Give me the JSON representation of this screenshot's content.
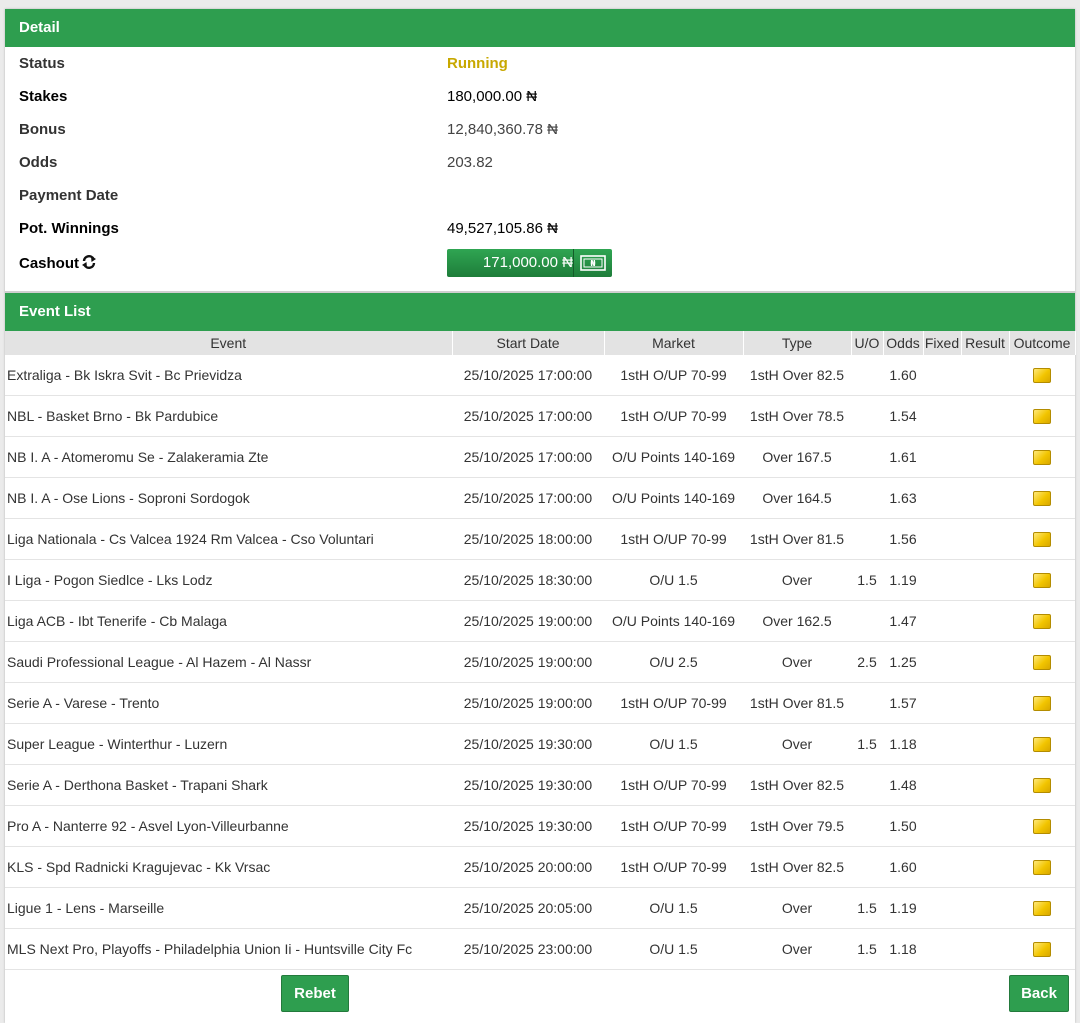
{
  "detail": {
    "header": "Detail",
    "status_label": "Status",
    "status_value": "Running",
    "stakes_label": "Stakes",
    "stakes_value": "180,000.00 ₦",
    "bonus_label": "Bonus",
    "bonus_value": "12,840,360.78 ₦",
    "odds_label": "Odds",
    "odds_value": "203.82",
    "payment_date_label": "Payment Date",
    "payment_date_value": "",
    "pot_winnings_label": "Pot. Winnings",
    "pot_winnings_value": "49,527,105.86 ₦",
    "cashout_label": "Cashout",
    "cashout_value": "171,000.00 ₦"
  },
  "events": {
    "header": "Event List",
    "columns": [
      "Event",
      "Start Date",
      "Market",
      "Type",
      "U/O",
      "Odds",
      "Fixed",
      "Result",
      "Outcome"
    ],
    "rows": [
      {
        "event": "Extraliga - Bk Iskra Svit - Bc Prievidza",
        "start": "25/10/2025 17:00:00",
        "market": "1stH O/UP 70-99",
        "type": "1stH Over 82.5",
        "uo": "",
        "odds": "1.60",
        "fixed": "",
        "result": ""
      },
      {
        "event": "NBL - Basket Brno - Bk Pardubice",
        "start": "25/10/2025 17:00:00",
        "market": "1stH O/UP 70-99",
        "type": "1stH Over 78.5",
        "uo": "",
        "odds": "1.54",
        "fixed": "",
        "result": ""
      },
      {
        "event": "NB I. A - Atomeromu Se - Zalakeramia Zte",
        "start": "25/10/2025 17:00:00",
        "market": "O/U Points 140-169",
        "type": "Over 167.5",
        "uo": "",
        "odds": "1.61",
        "fixed": "",
        "result": ""
      },
      {
        "event": "NB I. A - Ose Lions - Soproni Sordogok",
        "start": "25/10/2025 17:00:00",
        "market": "O/U Points 140-169",
        "type": "Over 164.5",
        "uo": "",
        "odds": "1.63",
        "fixed": "",
        "result": ""
      },
      {
        "event": "Liga Nationala - Cs Valcea 1924 Rm Valcea - Cso Voluntari",
        "start": "25/10/2025 18:00:00",
        "market": "1stH O/UP 70-99",
        "type": "1stH Over 81.5",
        "uo": "",
        "odds": "1.56",
        "fixed": "",
        "result": ""
      },
      {
        "event": "I Liga - Pogon Siedlce - Lks Lodz",
        "start": "25/10/2025 18:30:00",
        "market": "O/U 1.5",
        "type": "Over",
        "uo": "1.5",
        "odds": "1.19",
        "fixed": "",
        "result": ""
      },
      {
        "event": "Liga ACB - Ibt Tenerife - Cb Malaga",
        "start": "25/10/2025 19:00:00",
        "market": "O/U Points 140-169",
        "type": "Over 162.5",
        "uo": "",
        "odds": "1.47",
        "fixed": "",
        "result": ""
      },
      {
        "event": "Saudi Professional League - Al Hazem - Al Nassr",
        "start": "25/10/2025 19:00:00",
        "market": "O/U 2.5",
        "type": "Over",
        "uo": "2.5",
        "odds": "1.25",
        "fixed": "",
        "result": ""
      },
      {
        "event": "Serie A - Varese - Trento",
        "start": "25/10/2025 19:00:00",
        "market": "1stH O/UP 70-99",
        "type": "1stH Over 81.5",
        "uo": "",
        "odds": "1.57",
        "fixed": "",
        "result": ""
      },
      {
        "event": "Super League - Winterthur - Luzern",
        "start": "25/10/2025 19:30:00",
        "market": "O/U 1.5",
        "type": "Over",
        "uo": "1.5",
        "odds": "1.18",
        "fixed": "",
        "result": ""
      },
      {
        "event": "Serie A - Derthona Basket - Trapani Shark",
        "start": "25/10/2025 19:30:00",
        "market": "1stH O/UP 70-99",
        "type": "1stH Over 82.5",
        "uo": "",
        "odds": "1.48",
        "fixed": "",
        "result": ""
      },
      {
        "event": "Pro A - Nanterre 92 - Asvel Lyon-Villeurbanne",
        "start": "25/10/2025 19:30:00",
        "market": "1stH O/UP 70-99",
        "type": "1stH Over 79.5",
        "uo": "",
        "odds": "1.50",
        "fixed": "",
        "result": ""
      },
      {
        "event": "KLS - Spd Radnicki Kragujevac - Kk Vrsac",
        "start": "25/10/2025 20:00:00",
        "market": "1stH O/UP 70-99",
        "type": "1stH Over 82.5",
        "uo": "",
        "odds": "1.60",
        "fixed": "",
        "result": ""
      },
      {
        "event": "Ligue 1 - Lens - Marseille",
        "start": "25/10/2025 20:05:00",
        "market": "O/U 1.5",
        "type": "Over",
        "uo": "1.5",
        "odds": "1.19",
        "fixed": "",
        "result": ""
      },
      {
        "event": "MLS Next Pro, Playoffs - Philadelphia Union Ii - Huntsville City Fc",
        "start": "25/10/2025 23:00:00",
        "market": "O/U 1.5",
        "type": "Over",
        "uo": "1.5",
        "odds": "1.18",
        "fixed": "",
        "result": ""
      }
    ]
  },
  "footer": {
    "rebet_label": "Rebet",
    "back_label": "Back"
  },
  "icons": {
    "refresh": "refresh-icon",
    "cashout": "cash-note-icon",
    "outcome": "outcome-pending-icon"
  },
  "colors": {
    "header_green": "#2e9e4f",
    "running_status": "#c8a800",
    "outcome_yellow": "#f2c500"
  }
}
